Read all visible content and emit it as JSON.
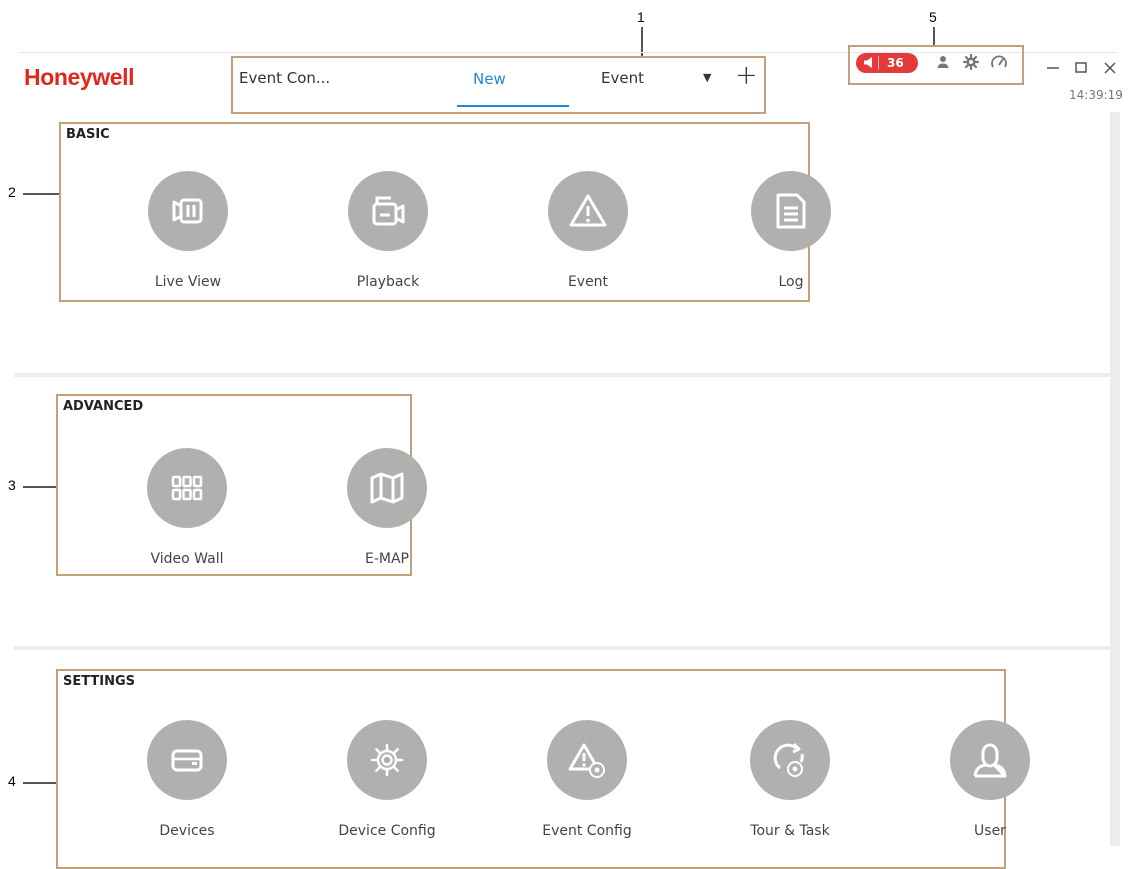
{
  "callouts": [
    "1",
    "2",
    "3",
    "4",
    "5"
  ],
  "brand": {
    "logo": "Honeywell"
  },
  "tabs": {
    "current_title": "Event Con...",
    "items": [
      {
        "label": "New",
        "active": true
      },
      {
        "label": "Event",
        "active": false
      }
    ],
    "dropdown_icon": "caret-down-icon",
    "add_icon": "plus-icon"
  },
  "toolbar": {
    "alarm_count": "36",
    "alarm_icon": "speaker-icon",
    "tools": [
      "user-icon",
      "gear-icon",
      "speedometer-icon"
    ]
  },
  "window_controls": [
    "minimize-icon",
    "maximize-icon",
    "close-icon"
  ],
  "clock": "14:39:19",
  "colors": {
    "brand_red": "#e1261c",
    "accent_blue": "#2586d8",
    "alarm_red": "#e33b3b",
    "icon_circle": "#b0b0b0",
    "callout_frame": "#c4a07a"
  },
  "sections": {
    "basic": {
      "title": "BASIC",
      "items": [
        {
          "label": "Live View",
          "icon": "live-view-icon"
        },
        {
          "label": "Playback",
          "icon": "playback-icon"
        },
        {
          "label": "Event",
          "icon": "event-warning-icon"
        },
        {
          "label": "Log",
          "icon": "log-document-icon"
        }
      ]
    },
    "advanced": {
      "title": "ADVANCED",
      "items": [
        {
          "label": "Video Wall",
          "icon": "video-wall-icon"
        },
        {
          "label": "E-MAP",
          "icon": "map-icon"
        }
      ]
    },
    "settings": {
      "title": "SETTINGS",
      "items": [
        {
          "label": "Devices",
          "icon": "devices-icon"
        },
        {
          "label": "Device Config",
          "icon": "device-config-icon"
        },
        {
          "label": "Event Config",
          "icon": "event-config-icon"
        },
        {
          "label": "Tour & Task",
          "icon": "tour-task-icon"
        },
        {
          "label": "User",
          "icon": "user-profile-icon"
        }
      ]
    }
  }
}
